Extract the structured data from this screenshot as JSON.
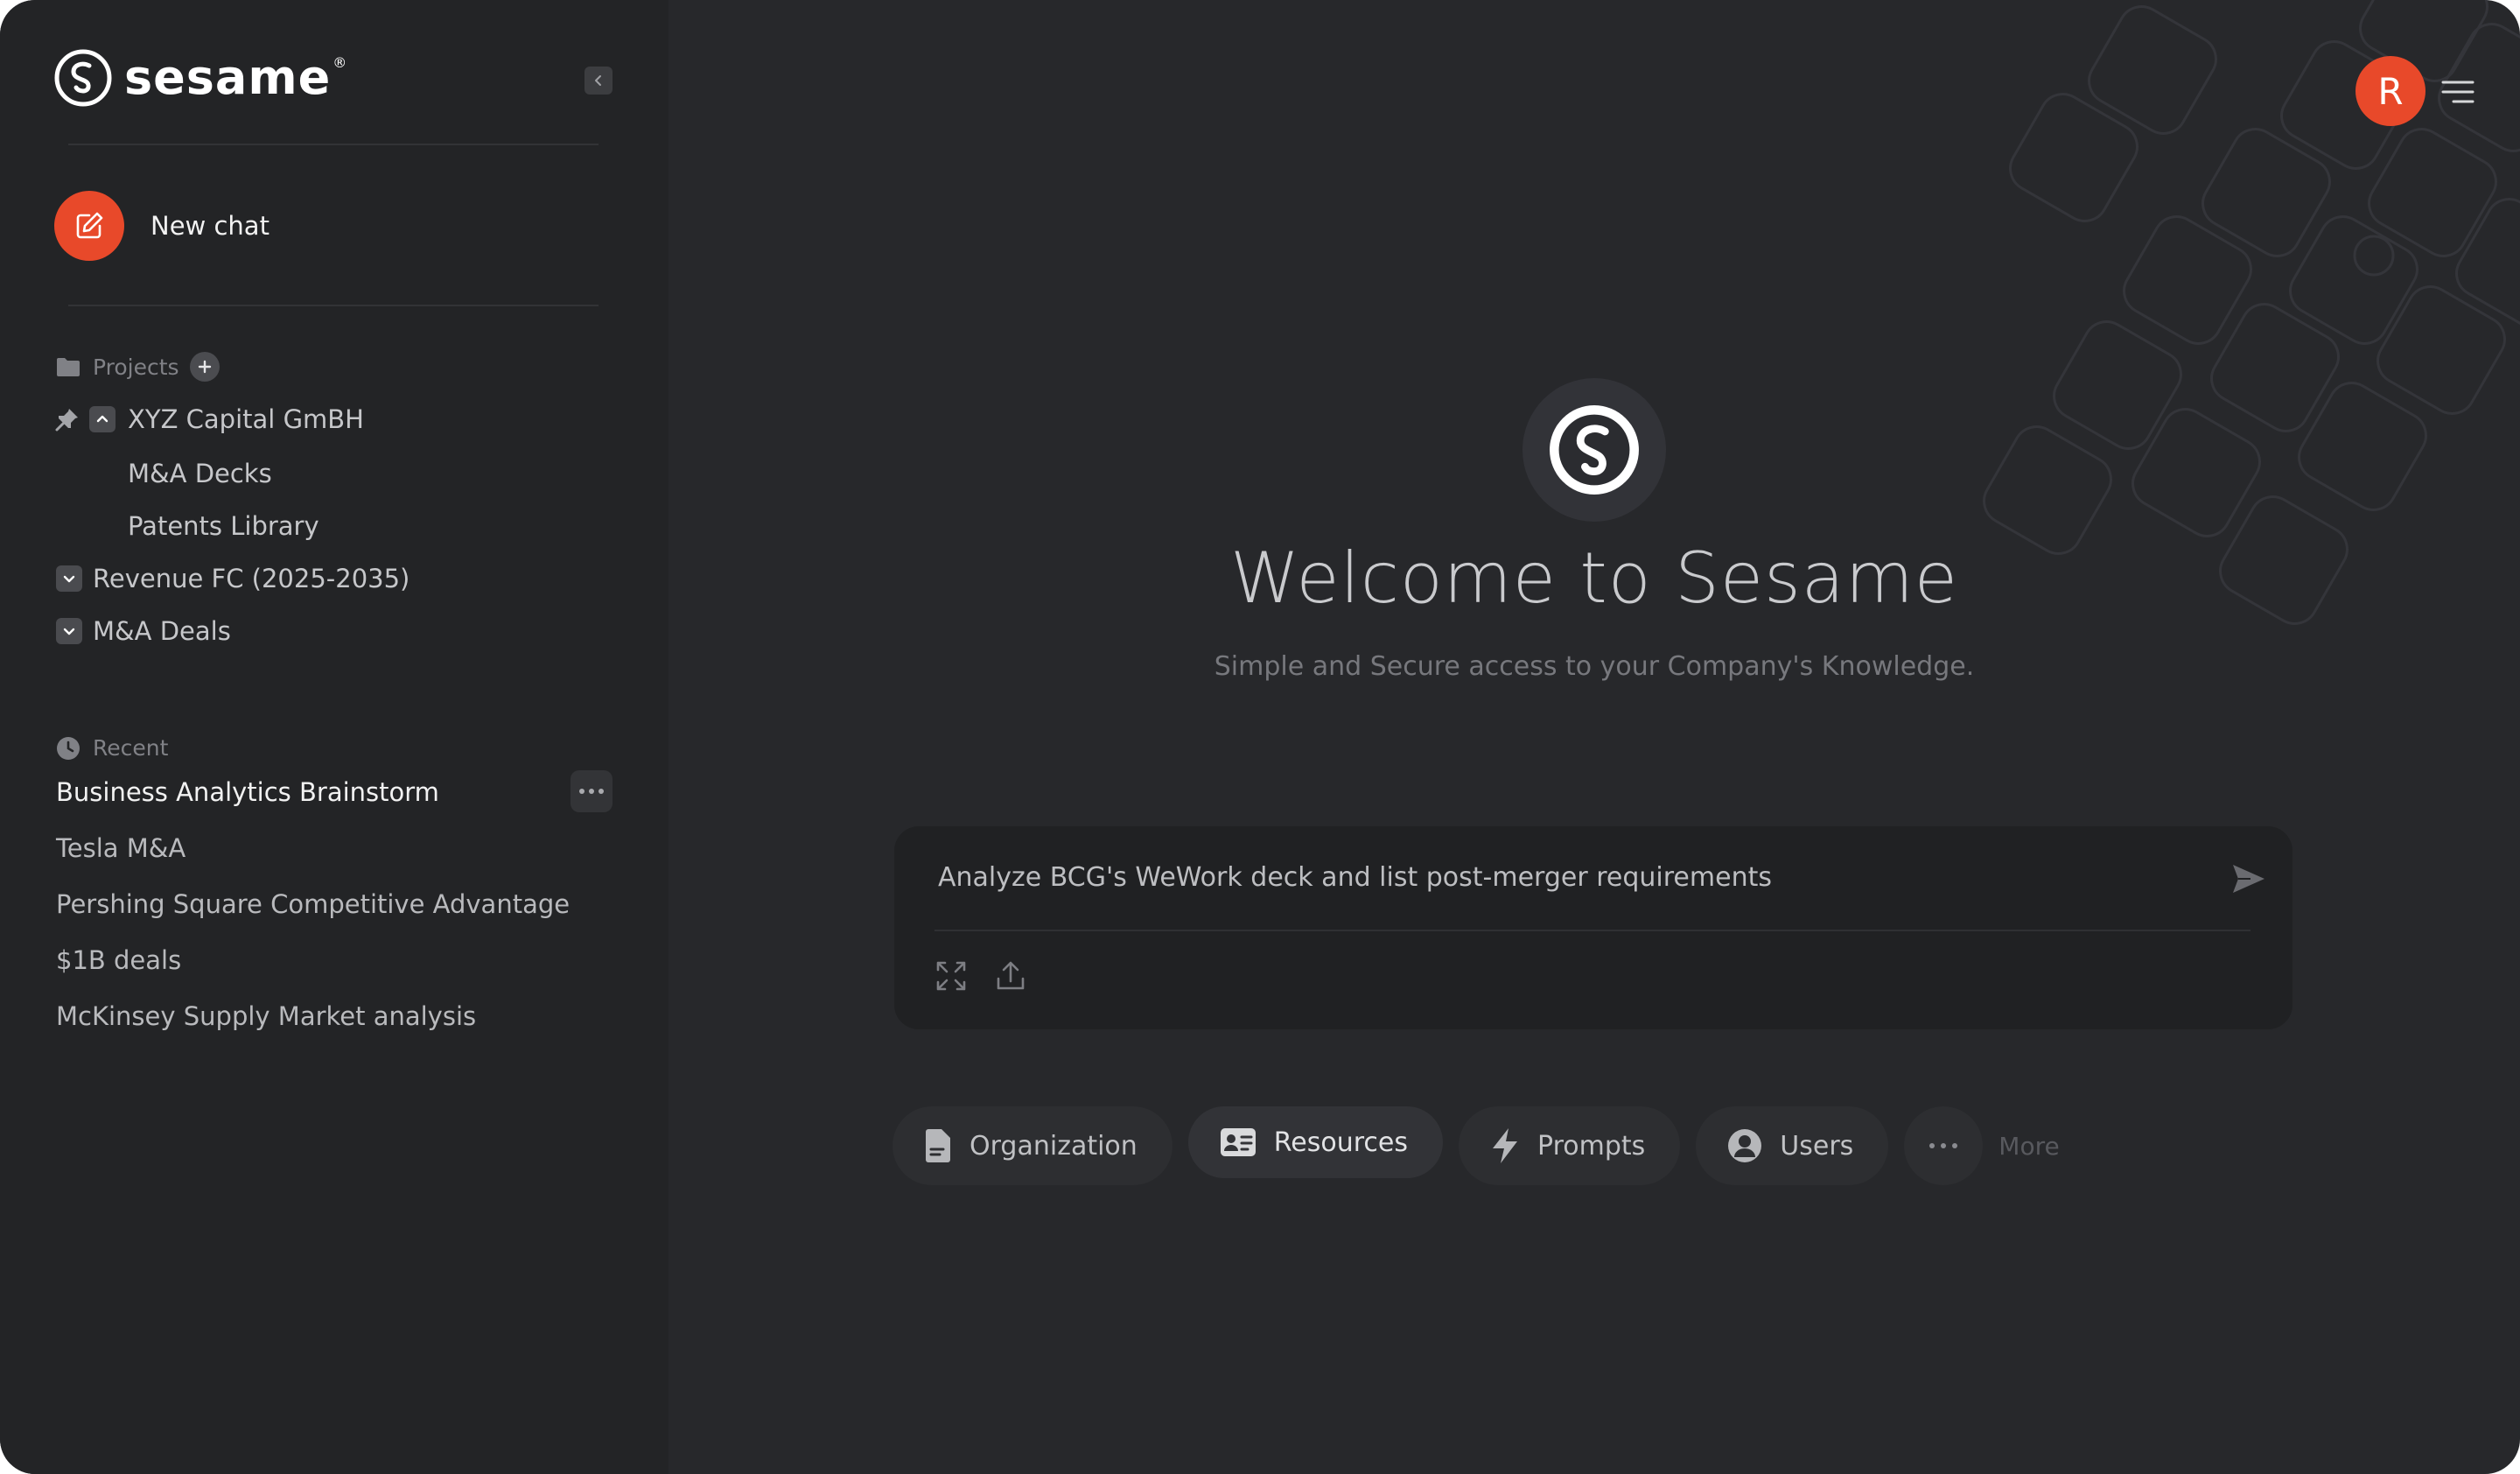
{
  "brand": {
    "name": "sesame",
    "registered": "®"
  },
  "new_chat": {
    "label": "New chat"
  },
  "projects": {
    "header": "Projects",
    "items": [
      {
        "label": "XYZ Capital GmBH",
        "pinned": true,
        "expanded": true,
        "children": [
          {
            "label": "M&A Decks"
          },
          {
            "label": "Patents Library"
          }
        ]
      },
      {
        "label": "Revenue FC (2025-2035)",
        "expanded": false
      },
      {
        "label": "M&A Deals",
        "expanded": false
      }
    ]
  },
  "recent": {
    "header": "Recent",
    "items": [
      {
        "label": "Business Analytics Brainstorm",
        "active": true
      },
      {
        "label": "Tesla M&A"
      },
      {
        "label": "Pershing Square Competitive Advantage"
      },
      {
        "label": "$1B deals"
      },
      {
        "label": "McKinsey Supply Market analysis"
      }
    ]
  },
  "user": {
    "avatar_initial": "R"
  },
  "hero": {
    "title": "Welcome to Sesame",
    "subtitle": "Simple and Secure access to your Company's Knowledge."
  },
  "composer": {
    "value": "Analyze BCG's WeWork deck and list post-merger requirements"
  },
  "chips": [
    {
      "label": "Organization",
      "icon": "document-icon"
    },
    {
      "label": "Resources",
      "icon": "id-card-icon"
    },
    {
      "label": "Prompts",
      "icon": "bolt-icon"
    },
    {
      "label": "Users",
      "icon": "user-circle-icon"
    }
  ],
  "more": {
    "label": "More"
  },
  "colors": {
    "accent": "#e8492a",
    "sidebar_bg": "#232426",
    "main_bg": "#27282b"
  }
}
